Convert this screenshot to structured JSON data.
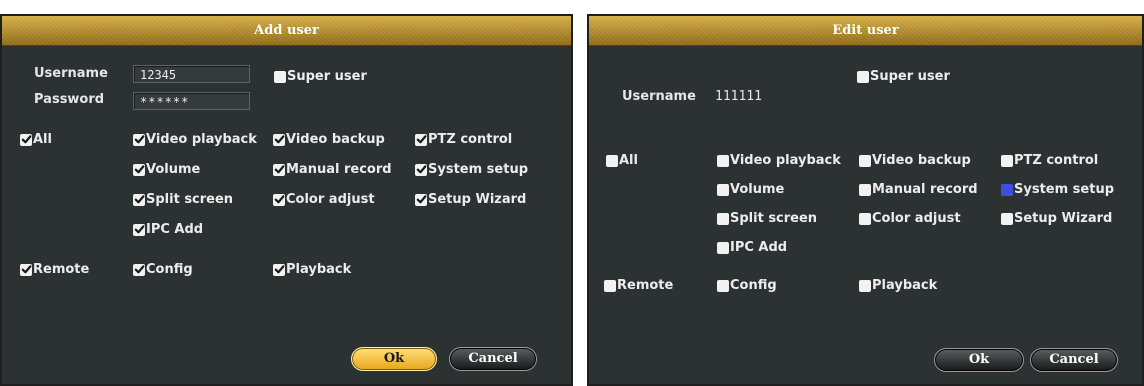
{
  "left": {
    "title": "Add user",
    "username_label": "Username",
    "username_value": "12345",
    "password_label": "Password",
    "password_value": "******",
    "super_user": {
      "label": "Super user",
      "checked": false
    },
    "perms": {
      "all": {
        "label": "All",
        "checked": true
      },
      "video_playback": {
        "label": "Video playback",
        "checked": true
      },
      "video_backup": {
        "label": "Video backup",
        "checked": true
      },
      "ptz_control": {
        "label": "PTZ control",
        "checked": true
      },
      "volume": {
        "label": "Volume",
        "checked": true
      },
      "manual_record": {
        "label": "Manual record",
        "checked": true
      },
      "system_setup": {
        "label": "System setup",
        "checked": true
      },
      "split_screen": {
        "label": "Split screen",
        "checked": true
      },
      "color_adjust": {
        "label": "Color adjust",
        "checked": true
      },
      "setup_wizard": {
        "label": "Setup Wizard",
        "checked": true
      },
      "ipc_add": {
        "label": "IPC Add",
        "checked": true
      },
      "remote": {
        "label": "Remote",
        "checked": true
      },
      "config": {
        "label": "Config",
        "checked": true
      },
      "playback": {
        "label": "Playback",
        "checked": true
      }
    },
    "ok_label": "Ok",
    "cancel_label": "Cancel"
  },
  "right": {
    "title": "Edit user",
    "username_label": "Username",
    "username_value": "111111",
    "super_user": {
      "label": "Super user",
      "checked": false
    },
    "perms": {
      "all": {
        "label": "All",
        "checked": false
      },
      "video_playback": {
        "label": "Video playback",
        "checked": false
      },
      "video_backup": {
        "label": "Video backup",
        "checked": false
      },
      "ptz_control": {
        "label": "PTZ control",
        "checked": false
      },
      "volume": {
        "label": "Volume",
        "checked": false
      },
      "manual_record": {
        "label": "Manual record",
        "checked": false
      },
      "system_setup": {
        "label": "System setup",
        "checked": false,
        "focused": true
      },
      "split_screen": {
        "label": "Split screen",
        "checked": false
      },
      "color_adjust": {
        "label": "Color adjust",
        "checked": false
      },
      "setup_wizard": {
        "label": "Setup Wizard",
        "checked": false
      },
      "ipc_add": {
        "label": "IPC Add",
        "checked": false
      },
      "remote": {
        "label": "Remote",
        "checked": false
      },
      "config": {
        "label": "Config",
        "checked": false
      },
      "playback": {
        "label": "Playback",
        "checked": false
      }
    },
    "ok_label": "Ok",
    "cancel_label": "Cancel"
  },
  "colors": {
    "panel_bg": "#2c3232",
    "title_gold": "#b98f2f",
    "checkbox_focus": "#3c4fe0",
    "ok_gold": "#f1bb35"
  }
}
